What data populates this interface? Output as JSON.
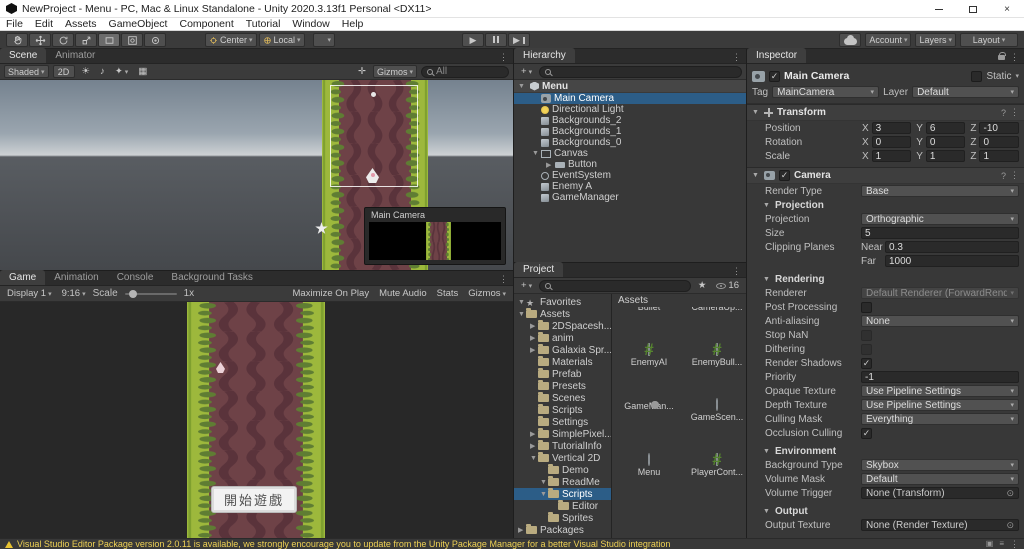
{
  "colors": {
    "sel": "#2c5d87",
    "warn": "#efd154",
    "road": "#6e4247",
    "road-stripe": "#5a333b",
    "grass": "#9db83c",
    "grass-dark": "#5f7d33"
  },
  "window": {
    "title": "NewProject - Menu - PC, Mac & Linux Standalone - Unity 2020.3.13f1 Personal <DX11>",
    "menus": [
      "File",
      "Edit",
      "Assets",
      "GameObject",
      "Component",
      "Tutorial",
      "Window",
      "Help"
    ]
  },
  "toolbar": {
    "pivot": "Center",
    "orientation": "Local",
    "account": "Account",
    "layers": "Layers",
    "layout": "Layout"
  },
  "scene": {
    "tabs": [
      {
        "label": "Scene",
        "active": true
      },
      {
        "label": "Animator",
        "active": false
      }
    ],
    "shading": "Shaded",
    "mode_2d": "2D",
    "gizmos": "Gizmos",
    "search_value": "All",
    "camera_preview_title": "Main Camera"
  },
  "game": {
    "tabs": [
      {
        "label": "Game",
        "active": true
      },
      {
        "label": "Animation",
        "active": false
      },
      {
        "label": "Console",
        "active": false
      },
      {
        "label": "Background Tasks",
        "active": false
      }
    ],
    "display": "Display 1",
    "aspect": "9:16",
    "scale_label": "Scale",
    "scale_value": "1x",
    "maximize": "Maximize On Play",
    "mute": "Mute Audio",
    "stats": "Stats",
    "gizmos": "Gizmos",
    "start_button": "開始遊戲"
  },
  "hierarchy": {
    "tab": "Hierarchy",
    "scene_name": "Menu",
    "items": [
      {
        "label": "Main Camera",
        "icon": "camera",
        "indent": 1,
        "selected": true
      },
      {
        "label": "Directional Light",
        "icon": "light",
        "indent": 1
      },
      {
        "label": "Backgrounds_2",
        "icon": "object",
        "indent": 1
      },
      {
        "label": "Backgrounds_1",
        "icon": "object",
        "indent": 1
      },
      {
        "label": "Backgrounds_0",
        "icon": "object",
        "indent": 1
      },
      {
        "label": "Canvas",
        "icon": "canvas",
        "indent": 1,
        "arrow": "▼"
      },
      {
        "label": "Button",
        "icon": "button",
        "indent": 2,
        "arrow": "▶"
      },
      {
        "label": "EventSystem",
        "icon": "event",
        "indent": 1
      },
      {
        "label": "Enemy A",
        "icon": "object",
        "indent": 1
      },
      {
        "label": "GameManager",
        "icon": "object",
        "indent": 1
      }
    ]
  },
  "project": {
    "tab": "Project",
    "folder_header": "Assets",
    "hidden_count": "16",
    "tree": [
      {
        "label": "Favorites",
        "icon": "star",
        "indent": 0,
        "arrow": "▼"
      },
      {
        "label": "Assets",
        "icon": "folder",
        "indent": 0,
        "arrow": "▼"
      },
      {
        "label": "2DSpacesh...",
        "icon": "folder",
        "indent": 1,
        "arrow": "▶"
      },
      {
        "label": "anim",
        "icon": "folder",
        "indent": 1,
        "arrow": "▶"
      },
      {
        "label": "Galaxia Spr...",
        "icon": "folder",
        "indent": 1,
        "arrow": "▶"
      },
      {
        "label": "Materials",
        "icon": "folder",
        "indent": 1
      },
      {
        "label": "Prefab",
        "icon": "folder",
        "indent": 1
      },
      {
        "label": "Presets",
        "icon": "folder",
        "indent": 1
      },
      {
        "label": "Scenes",
        "icon": "folder",
        "indent": 1
      },
      {
        "label": "Scripts",
        "icon": "folder",
        "indent": 1
      },
      {
        "label": "Settings",
        "icon": "folder",
        "indent": 1
      },
      {
        "label": "SimplePixel...",
        "icon": "folder",
        "indent": 1,
        "arrow": "▶"
      },
      {
        "label": "TutorialInfo",
        "icon": "folder",
        "indent": 1,
        "arrow": "▶"
      },
      {
        "label": "Vertical 2D",
        "icon": "folder",
        "indent": 1,
        "arrow": "▼"
      },
      {
        "label": "Demo",
        "icon": "folder",
        "indent": 2
      },
      {
        "label": "ReadMe",
        "icon": "folder",
        "indent": 2,
        "arrow": "▼"
      },
      {
        "label": "Scripts",
        "icon": "folder",
        "indent": 2,
        "selected": true,
        "arrow": "▼"
      },
      {
        "label": "Editor",
        "icon": "folder",
        "indent": 3
      },
      {
        "label": "Sprites",
        "icon": "folder",
        "indent": 2
      },
      {
        "label": "Packages",
        "icon": "folder",
        "indent": 0,
        "arrow": "▶"
      }
    ],
    "assets": [
      {
        "label": "Bullet",
        "icon": "script"
      },
      {
        "label": "CameraUp...",
        "icon": "script"
      },
      {
        "label": "EnemyAI",
        "icon": "script"
      },
      {
        "label": "EnemyBull...",
        "icon": "script"
      },
      {
        "label": "GameMan...",
        "icon": "gear"
      },
      {
        "label": "GameScen...",
        "icon": "unity"
      },
      {
        "label": "Menu",
        "icon": "unity"
      },
      {
        "label": "PlayerCont...",
        "icon": "script"
      }
    ]
  },
  "inspector": {
    "tab": "Inspector",
    "name": "Main Camera",
    "static_label": "Static",
    "tag_label": "Tag",
    "tag_value": "MainCamera",
    "layer_label": "Layer",
    "layer_value": "Default",
    "transform": {
      "title": "Transform",
      "axes": [
        "X",
        "Y",
        "Z"
      ],
      "rows": [
        {
          "label": "Position",
          "x": "3",
          "y": "6",
          "z": "-10"
        },
        {
          "label": "Rotation",
          "x": "0",
          "y": "0",
          "z": "0"
        },
        {
          "label": "Scale",
          "x": "1",
          "y": "1",
          "z": "1"
        }
      ]
    },
    "camera": {
      "title": "Camera",
      "main_rows": [
        {
          "label": "Render Type",
          "value": "Base",
          "control": "dropdown"
        }
      ],
      "projection": {
        "title": "Projection",
        "rows": [
          {
            "label": "Projection",
            "value": "Orthographic",
            "control": "dropdown"
          },
          {
            "label": "Size",
            "value": "5",
            "control": "field"
          },
          {
            "label": "Clipping Planes",
            "sub": "Near",
            "value": "0.3",
            "control": "subfield"
          },
          {
            "label": "",
            "sub": "Far",
            "value": "1000",
            "control": "subfield"
          }
        ]
      },
      "rendering": {
        "title": "Rendering",
        "rows": [
          {
            "label": "Renderer",
            "value": "Default Renderer (ForwardRenderer)",
            "control": "dropdown",
            "disabled": true
          },
          {
            "label": "Post Processing",
            "control": "checkbox"
          },
          {
            "label": "Anti-aliasing",
            "value": "None",
            "control": "dropdown"
          },
          {
            "label": "Stop NaN",
            "control": "checkbox",
            "disabled": true
          },
          {
            "label": "Dithering",
            "control": "checkbox",
            "disabled": true
          },
          {
            "label": "Render Shadows",
            "control": "checkbox",
            "checked": true
          },
          {
            "label": "Priority",
            "value": "-1",
            "control": "field"
          },
          {
            "label": "Opaque Texture",
            "value": "Use Pipeline Settings",
            "control": "dropdown"
          },
          {
            "label": "Depth Texture",
            "value": "Use Pipeline Settings",
            "control": "dropdown"
          },
          {
            "label": "Culling Mask",
            "value": "Everything",
            "control": "dropdown"
          },
          {
            "label": "Occlusion Culling",
            "control": "checkbox",
            "checked": true
          }
        ]
      },
      "environment": {
        "title": "Environment",
        "rows": [
          {
            "label": "Background Type",
            "value": "Skybox",
            "control": "dropdown"
          },
          {
            "label": "Volume Mask",
            "value": "Default",
            "control": "dropdown"
          },
          {
            "label": "Volume Trigger",
            "value": "None (Transform)",
            "control": "object"
          }
        ]
      },
      "output": {
        "title": "Output",
        "rows": [
          {
            "label": "Output Texture",
            "value": "None (Render Texture)",
            "control": "object"
          }
        ]
      }
    }
  },
  "status": {
    "message": "Visual Studio Editor Package version 2.0.11 is available, we strongly encourage you to update from the Unity Package Manager for a better Visual Studio integration"
  }
}
